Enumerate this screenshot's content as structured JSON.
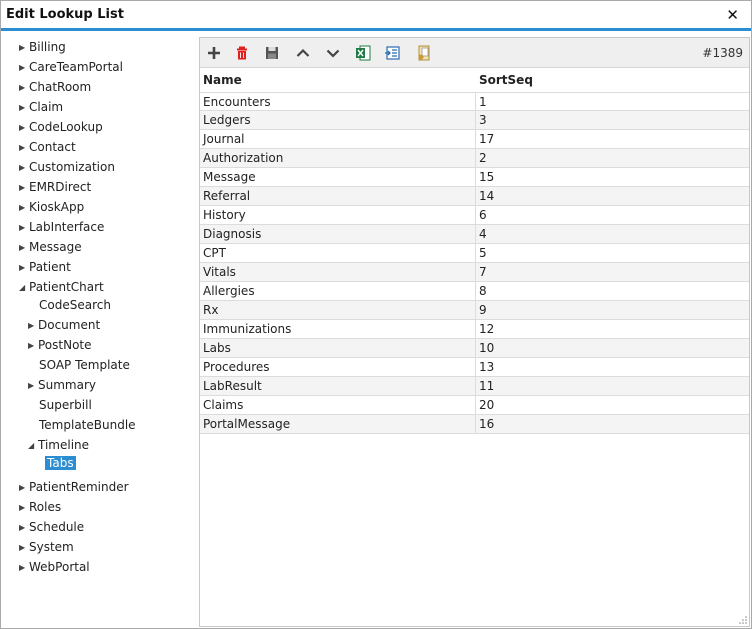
{
  "dialog": {
    "title": "Edit Lookup List"
  },
  "tree": [
    {
      "label": "Billing",
      "level": 0,
      "state": "collapsed"
    },
    {
      "label": "CareTeamPortal",
      "level": 0,
      "state": "collapsed"
    },
    {
      "label": "ChatRoom",
      "level": 0,
      "state": "collapsed"
    },
    {
      "label": "Claim",
      "level": 0,
      "state": "collapsed"
    },
    {
      "label": "CodeLookup",
      "level": 0,
      "state": "collapsed"
    },
    {
      "label": "Contact",
      "level": 0,
      "state": "collapsed"
    },
    {
      "label": "Customization",
      "level": 0,
      "state": "collapsed"
    },
    {
      "label": "EMRDirect",
      "level": 0,
      "state": "collapsed"
    },
    {
      "label": "KioskApp",
      "level": 0,
      "state": "collapsed"
    },
    {
      "label": "LabInterface",
      "level": 0,
      "state": "collapsed"
    },
    {
      "label": "Message",
      "level": 0,
      "state": "collapsed"
    },
    {
      "label": "Patient",
      "level": 0,
      "state": "collapsed"
    },
    {
      "label": "PatientChart",
      "level": 0,
      "state": "expanded"
    },
    {
      "label": "CodeSearch",
      "level": 1,
      "state": "leaf"
    },
    {
      "label": "Document",
      "level": 1,
      "state": "collapsed"
    },
    {
      "label": "PostNote",
      "level": 1,
      "state": "collapsed"
    },
    {
      "label": "SOAP Template",
      "level": 1,
      "state": "leaf"
    },
    {
      "label": "Summary",
      "level": 1,
      "state": "collapsed"
    },
    {
      "label": "Superbill",
      "level": 1,
      "state": "leaf"
    },
    {
      "label": "TemplateBundle",
      "level": 1,
      "state": "leaf"
    },
    {
      "label": "Timeline",
      "level": 1,
      "state": "expanded"
    },
    {
      "label": "Tabs",
      "level": 2,
      "state": "selected"
    },
    {
      "label": "PatientReminder",
      "level": 0,
      "state": "collapsed"
    },
    {
      "label": "Roles",
      "level": 0,
      "state": "collapsed"
    },
    {
      "label": "Schedule",
      "level": 0,
      "state": "collapsed"
    },
    {
      "label": "System",
      "level": 0,
      "state": "collapsed"
    },
    {
      "label": "WebPortal",
      "level": 0,
      "state": "collapsed"
    }
  ],
  "toolbar": {
    "buttons": [
      "add-icon",
      "delete-icon",
      "save-icon",
      "move-up-icon",
      "move-down-icon",
      "export-excel-icon",
      "export-csv-icon",
      "import-icon"
    ],
    "record_id": "#1389"
  },
  "grid": {
    "columns": [
      "Name",
      "SortSeq"
    ],
    "rows": [
      [
        "Encounters",
        "1"
      ],
      [
        "Ledgers",
        "3"
      ],
      [
        "Journal",
        "17"
      ],
      [
        "Authorization",
        "2"
      ],
      [
        "Message",
        "15"
      ],
      [
        "Referral",
        "14"
      ],
      [
        "History",
        "6"
      ],
      [
        "Diagnosis",
        "4"
      ],
      [
        "CPT",
        "5"
      ],
      [
        "Vitals",
        "7"
      ],
      [
        "Allergies",
        "8"
      ],
      [
        "Rx",
        "9"
      ],
      [
        "Immunizations",
        "12"
      ],
      [
        "Labs",
        "10"
      ],
      [
        "Procedures",
        "13"
      ],
      [
        "LabResult",
        "11"
      ],
      [
        "Claims",
        "20"
      ],
      [
        "PortalMessage",
        "16"
      ]
    ]
  },
  "colors": {
    "accent": "#2b8ed2",
    "delete": "#e02020",
    "excel": "#1e7b45"
  }
}
